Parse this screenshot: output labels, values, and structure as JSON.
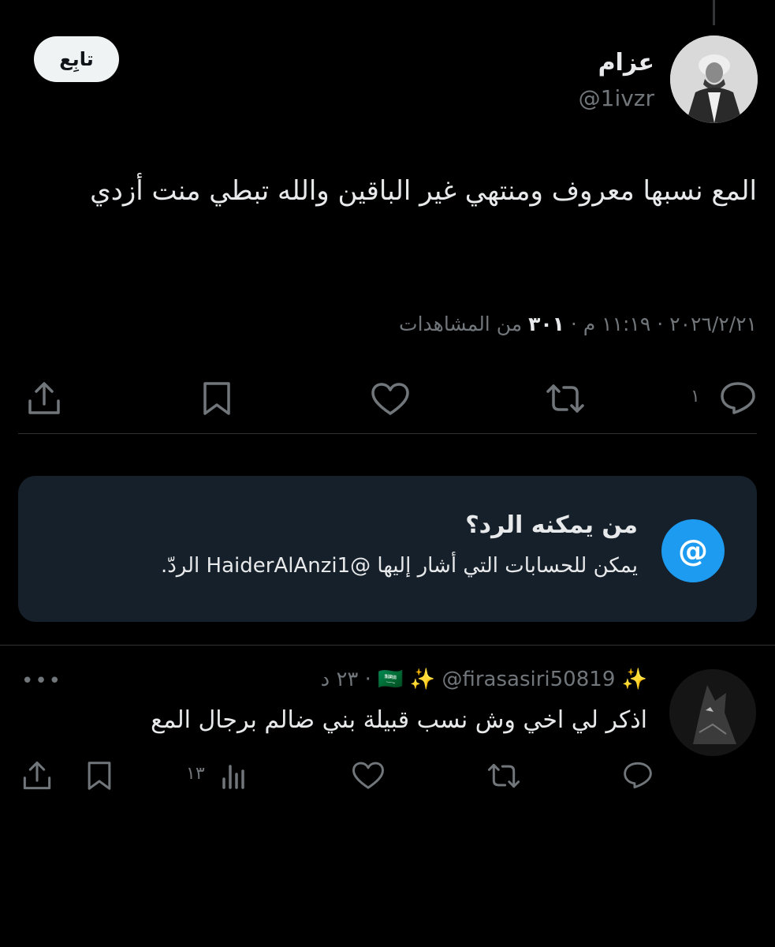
{
  "tweet": {
    "author_name": "عزام",
    "author_handle": "@1ivzr",
    "follow_label": "تابِع",
    "text": "المع نسبها معروف ومنتهي غير الباقين والله تبطي منت أزدي",
    "date": "٢٠٢٦/٢/٢١",
    "time": "١١:١٩ م",
    "separator": "·",
    "views_count": "٣٠١",
    "views_label": "من المشاهدات",
    "actions": {
      "reply_count": "١",
      "reply_icon": "comment-icon",
      "retweet_icon": "retweet-icon",
      "like_icon": "heart-icon",
      "bookmark_icon": "bookmark-icon",
      "share_icon": "share-icon"
    }
  },
  "reply_restriction": {
    "icon": "at-icon",
    "symbol": "@",
    "title": "من يمكنه الرد؟",
    "description": "يمكن للحسابات التي أشار إليها @HaiderAlAnzi1 الردّ."
  },
  "reply": {
    "name_emojis": "✨ 🇸🇦 ✨",
    "handle": "@firasasiri50819",
    "separator": "·",
    "age": "٢٣ د",
    "text": "اذكر لي اخي وش نسب قبيلة بني ضالم برجال المع",
    "more_label": "•••",
    "actions": {
      "views_count": "١٣",
      "reply_icon": "comment-icon",
      "retweet_icon": "retweet-icon",
      "like_icon": "heart-icon",
      "views_icon": "analytics-icon",
      "bookmark_icon": "bookmark-icon",
      "share_icon": "share-icon"
    }
  },
  "colors": {
    "background": "#000000",
    "text": "#e7e9ea",
    "muted": "#71767b",
    "accent": "#1d9bf0",
    "card": "#16202a"
  }
}
